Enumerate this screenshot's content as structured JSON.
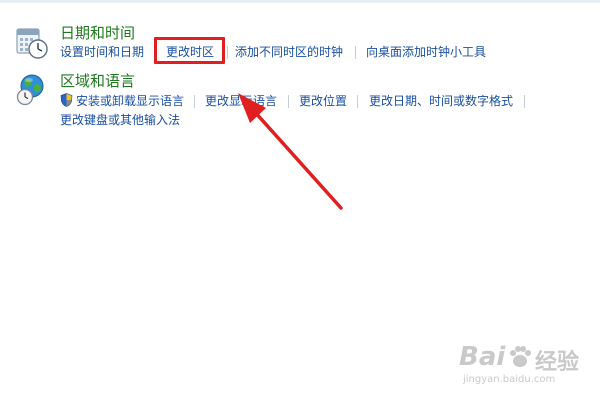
{
  "datetime": {
    "title": "日期和时间",
    "links": {
      "set_time_date": "设置时间和日期",
      "change_timezone": "更改时区",
      "add_clocks": "添加不同时区的时钟",
      "add_clock_gadget": "向桌面添加时钟小工具"
    },
    "icon": "calendar-clock-icon"
  },
  "region_language": {
    "title": "区域和语言",
    "links": {
      "install_display_language": "安装或卸载显示语言",
      "change_display_language": "更改显示语言",
      "change_location": "更改位置",
      "change_date_time_number_format": "更改日期、时间或数字格式",
      "change_keyboard_input": "更改键盘或其他输入法"
    },
    "icon": "globe-clock-icon"
  },
  "annotation": {
    "highlight_color": "#e02020",
    "arrow_color": "#e02020"
  },
  "watermark": {
    "brand": "Bai",
    "brand2": "经验",
    "url": "jingyan.baidu.com",
    "icon": "baidu-paw-icon"
  }
}
